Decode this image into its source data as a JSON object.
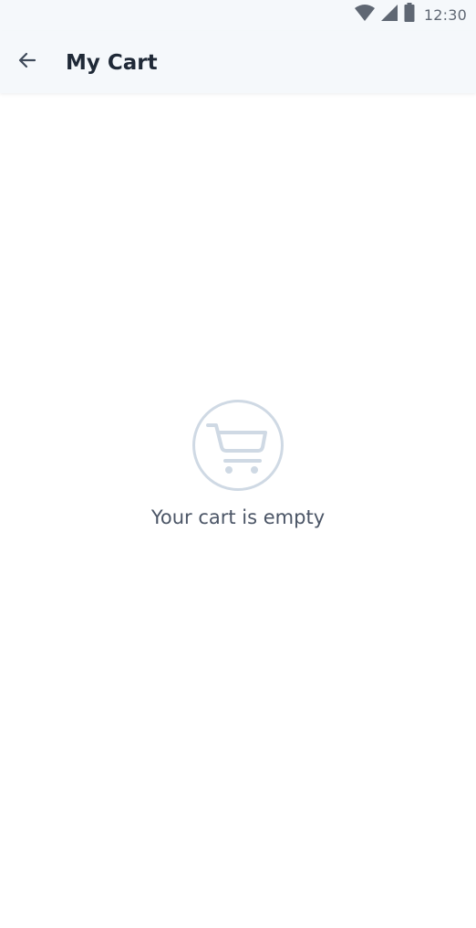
{
  "status_bar": {
    "time": "12:30",
    "icons": [
      "wifi-icon",
      "signal-icon",
      "battery-icon"
    ]
  },
  "header": {
    "back_icon": "arrow-left-icon",
    "title": "My Cart"
  },
  "empty_state": {
    "icon": "shopping-cart-icon",
    "message": "Your cart is empty"
  },
  "colors": {
    "app_bar_bg": "#f5f8fb",
    "title_text": "#1f2937",
    "message_text": "#4b5566",
    "icon_muted": "#cfd9e4"
  }
}
